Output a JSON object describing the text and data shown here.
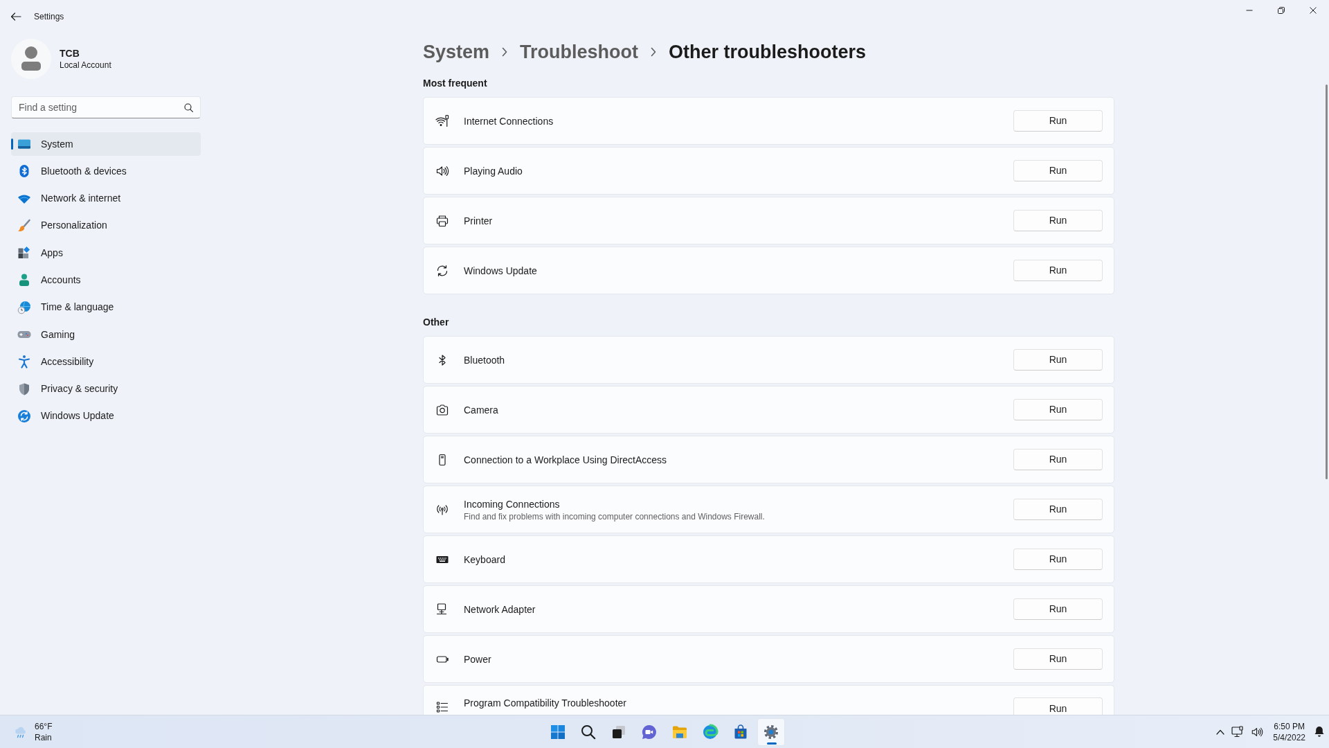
{
  "window": {
    "title": "Settings"
  },
  "account": {
    "name": "TCB",
    "type": "Local Account"
  },
  "search": {
    "placeholder": "Find a setting"
  },
  "sidebar": {
    "items": [
      {
        "label": "System",
        "selected": true
      },
      {
        "label": "Bluetooth & devices",
        "selected": false
      },
      {
        "label": "Network & internet",
        "selected": false
      },
      {
        "label": "Personalization",
        "selected": false
      },
      {
        "label": "Apps",
        "selected": false
      },
      {
        "label": "Accounts",
        "selected": false
      },
      {
        "label": "Time & language",
        "selected": false
      },
      {
        "label": "Gaming",
        "selected": false
      },
      {
        "label": "Accessibility",
        "selected": false
      },
      {
        "label": "Privacy & security",
        "selected": false
      },
      {
        "label": "Windows Update",
        "selected": false
      }
    ]
  },
  "breadcrumb": [
    {
      "label": "System",
      "current": false
    },
    {
      "label": "Troubleshoot",
      "current": false
    },
    {
      "label": "Other troubleshooters",
      "current": true
    }
  ],
  "sections": [
    {
      "title": "Most frequent",
      "items": [
        {
          "title": "Internet Connections",
          "button": "Run"
        },
        {
          "title": "Playing Audio",
          "button": "Run"
        },
        {
          "title": "Printer",
          "button": "Run"
        },
        {
          "title": "Windows Update",
          "button": "Run"
        }
      ]
    },
    {
      "title": "Other",
      "items": [
        {
          "title": "Bluetooth",
          "button": "Run"
        },
        {
          "title": "Camera",
          "button": "Run"
        },
        {
          "title": "Connection to a Workplace Using DirectAccess",
          "button": "Run"
        },
        {
          "title": "Incoming Connections",
          "description": "Find and fix problems with incoming computer connections and Windows Firewall.",
          "button": "Run"
        },
        {
          "title": "Keyboard",
          "button": "Run"
        },
        {
          "title": "Network Adapter",
          "button": "Run"
        },
        {
          "title": "Power",
          "button": "Run"
        },
        {
          "title": "Program Compatibility Troubleshooter",
          "button": "Run"
        }
      ]
    }
  ],
  "taskbar": {
    "weather": {
      "temperature": "66°F",
      "condition": "Rain"
    },
    "apps": [
      {
        "active": false
      },
      {
        "active": false
      },
      {
        "active": false
      },
      {
        "active": false
      },
      {
        "active": false
      },
      {
        "active": false
      },
      {
        "active": false
      },
      {
        "active": true
      }
    ],
    "tray": {
      "time": "6:50 PM",
      "date": "5/4/2022"
    }
  }
}
